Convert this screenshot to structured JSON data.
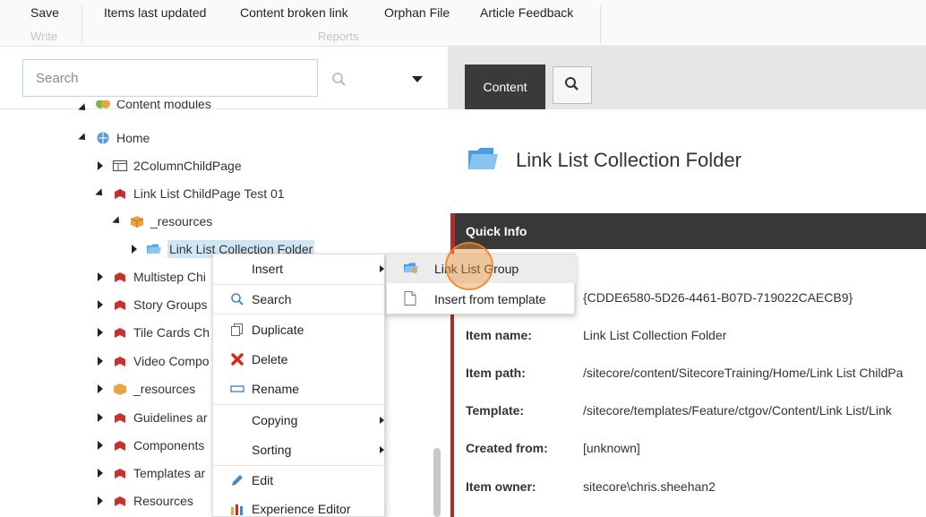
{
  "ribbon": {
    "buttons": [
      "Save",
      "Items last updated",
      "Content broken link",
      "Orphan File",
      "Article Feedback"
    ],
    "groups": [
      "Write",
      "Reports"
    ]
  },
  "search": {
    "placeholder": "Search"
  },
  "tree": {
    "cut_off_top": "Content modules",
    "home": "Home",
    "two_column": "2ColumnChildPage",
    "link_list_page": "Link List ChildPage Test 01",
    "resources_child": "_resources",
    "selected": "Link List Collection Folder",
    "multistep": "Multistep Chi",
    "story_groups": "Story Groups",
    "tile_cards": "Tile Cards Ch",
    "video": "Video Compo",
    "resources": "_resources",
    "guidelines": "Guidelines ar",
    "components": "Components",
    "templates": "Templates ar",
    "resources_folder": "Resources"
  },
  "context_menu": {
    "insert": "Insert",
    "search": "Search",
    "duplicate": "Duplicate",
    "delete": "Delete",
    "rename": "Rename",
    "copying": "Copying",
    "sorting": "Sorting",
    "edit": "Edit",
    "experience_editor": "Experience Editor"
  },
  "submenu": {
    "link_list_group": "Link List Group",
    "insert_from_template": "Insert from template"
  },
  "content": {
    "tab_label": "Content",
    "item_title": "Link List Collection Folder",
    "quick_info_header": "Quick Info",
    "item_id": "{CDDE6580-5D26-4461-B07D-719022CAECB9}",
    "fields": [
      {
        "label": "Item name:",
        "value": "Link List Collection Folder"
      },
      {
        "label": "Item path:",
        "value": "/sitecore/content/SitecoreTraining/Home/Link List ChildPa"
      },
      {
        "label": "Template:",
        "value": "/sitecore/templates/Feature/ctgov/Content/Link List/Link"
      },
      {
        "label": "Created from:",
        "value": "[unknown]"
      },
      {
        "label": "Item owner:",
        "value": "sitecore\\chris.sheehan2"
      }
    ]
  },
  "colors": {
    "accent_red": "#b52b28",
    "dark_header": "#383838",
    "selection_blue": "#cfe6f7",
    "click_highlight": "#f0963c"
  }
}
